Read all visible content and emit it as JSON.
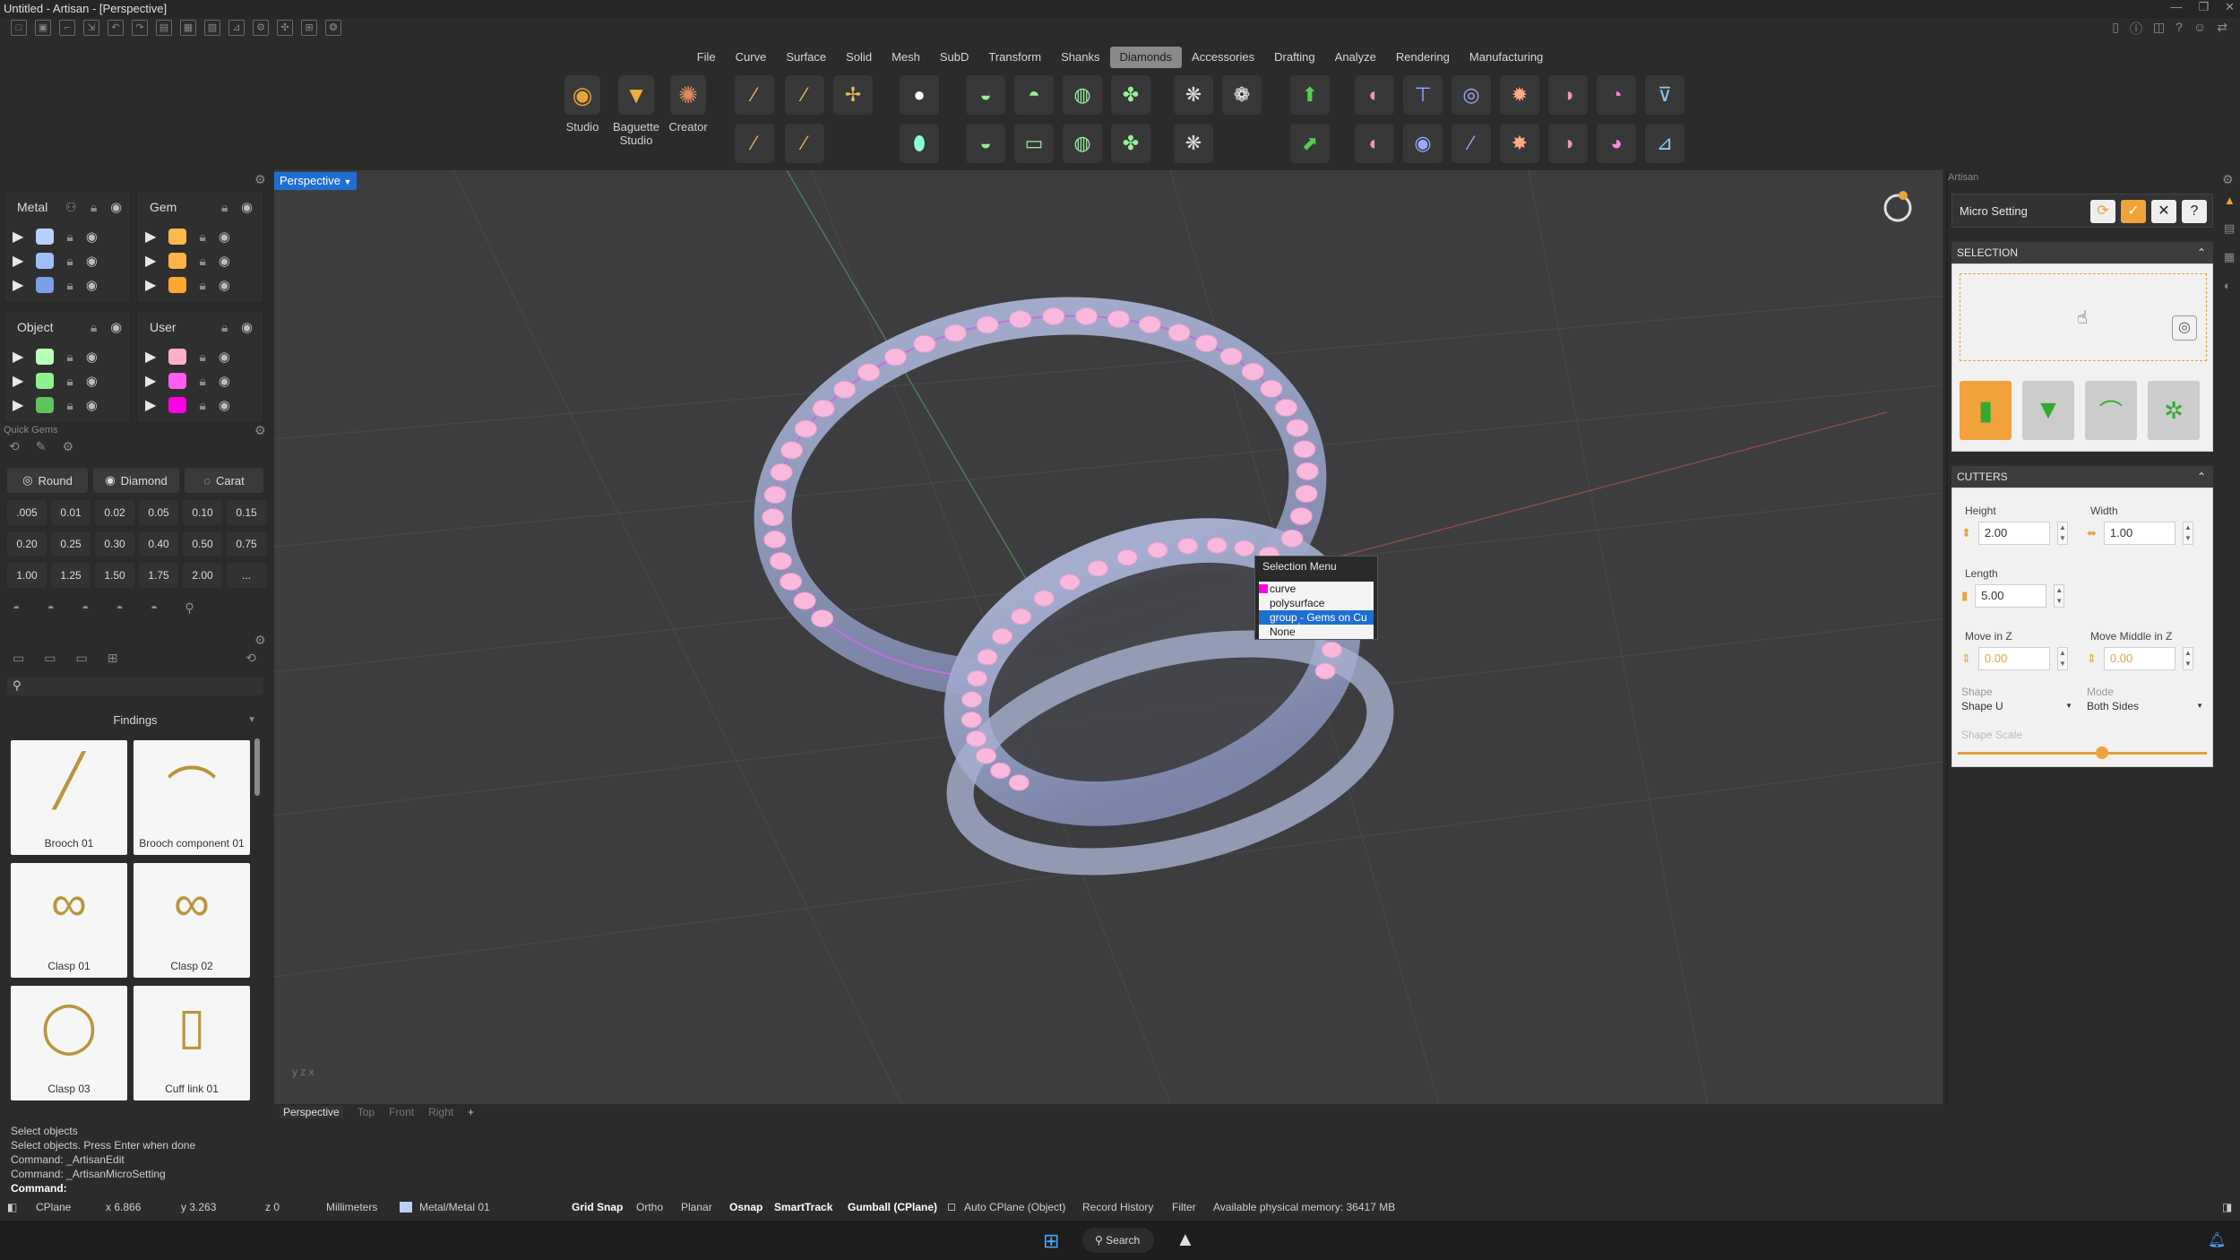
{
  "window": {
    "title": "Untitled - Artisan - [Perspective]"
  },
  "menus": [
    "File",
    "Curve",
    "Surface",
    "Solid",
    "Mesh",
    "SubD",
    "Transform",
    "Shanks",
    "Diamonds",
    "Accessories",
    "Drafting",
    "Analyze",
    "Rendering",
    "Manufacturing"
  ],
  "active_menu": "Diamonds",
  "ribbon": {
    "studio": "Studio",
    "baguette": "Baguette Studio",
    "creator": "Creator"
  },
  "layers": {
    "metal": {
      "label": "Metal",
      "colors": [
        "#b9cfff",
        "#9fbef9",
        "#7a9ee8"
      ]
    },
    "gem": {
      "label": "Gem",
      "colors": [
        "#ffb84c",
        "#ffb347",
        "#ffa62e"
      ]
    },
    "object": {
      "label": "Object",
      "colors": [
        "#b8ffb8",
        "#8ef08e",
        "#5cc45c"
      ]
    },
    "user": {
      "label": "User",
      "colors": [
        "#ffb0c8",
        "#ff5cf2",
        "#ff00e6"
      ]
    }
  },
  "quick_gems": {
    "title": "Quick Gems",
    "shape": "Round",
    "material": "Diamond",
    "unit": "Carat",
    "sizes": [
      ".005",
      "0.01",
      "0.02",
      "0.05",
      "0.10",
      "0.15",
      "0.20",
      "0.25",
      "0.30",
      "0.40",
      "0.50",
      "0.75",
      "1.00",
      "1.25",
      "1.50",
      "1.75",
      "2.00",
      "..."
    ]
  },
  "findings": {
    "category": "Findings",
    "items": [
      "Brooch 01",
      "Brooch component 01",
      "Clasp 01",
      "Clasp 02",
      "Clasp 03",
      "Cuff link 01"
    ]
  },
  "viewport": {
    "name": "Perspective",
    "tabs": [
      "Perspective",
      "Top",
      "Front",
      "Right",
      "+"
    ]
  },
  "selection_menu": {
    "title": "Selection Menu",
    "items": [
      "curve",
      "polysurface",
      "group - Gems on Cu",
      "None"
    ],
    "selected": 2
  },
  "right_panel": {
    "header": "Artisan",
    "tool": "Micro Setting",
    "selection_section": "SELECTION",
    "cutters_section": "CUTTERS",
    "height_label": "Height",
    "height": "2.00",
    "width_label": "Width",
    "width": "1.00",
    "length_label": "Length",
    "length": "5.00",
    "movez_label": "Move in Z",
    "movez": "0.00",
    "movemid_label": "Move Middle in Z",
    "movemid": "0.00",
    "shape_label": "Shape",
    "shape": "Shape U",
    "mode_label": "Mode",
    "mode": "Both Sides",
    "shapescale_label": "Shape Scale",
    "shapescale": 0.58
  },
  "command": {
    "lines": [
      "Select objects",
      "Select objects. Press Enter when done",
      "Command: _ArtisanEdit",
      "Command: _ArtisanMicroSetting"
    ],
    "prompt": "Command:"
  },
  "status": {
    "cplane": "CPlane",
    "x": "x 6.866",
    "y": "y 3.263",
    "z": "z 0",
    "units": "Millimeters",
    "layer": "Metal/Metal 01",
    "toggles": [
      "Grid Snap",
      "Ortho",
      "Planar",
      "Osnap",
      "SmartTrack",
      "Gumball (CPlane)"
    ],
    "auto_cplane": "Auto CPlane (Object)",
    "record": "Record History",
    "filter": "Filter",
    "memory": "Available physical memory: 36417 MB"
  },
  "taskbar": {
    "search": "Search"
  }
}
